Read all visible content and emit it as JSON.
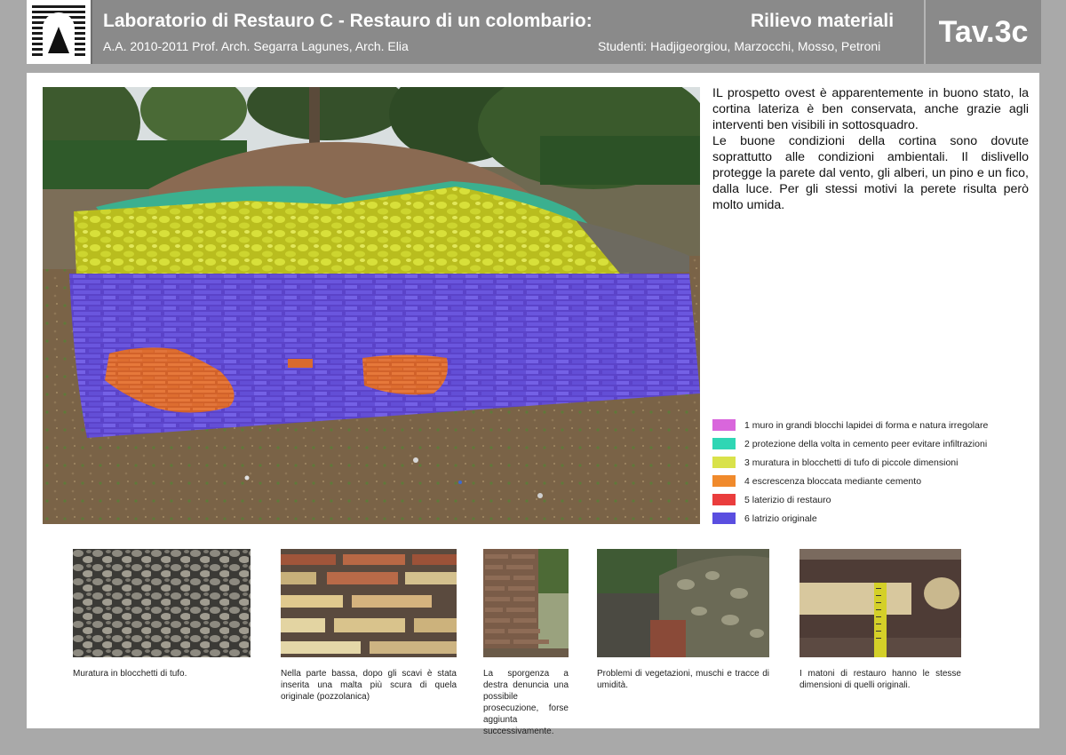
{
  "header": {
    "title": "Laboratorio di Restauro C - Restauro di un colombario:",
    "subtitle": "A.A. 2010-2011 Prof. Arch. Segarra Lagunes, Arch. Elia",
    "right_title": "Rilievo materiali",
    "right_subtitle": "Studenti: Hadjigeorgiou, Marzocchi, Mosso, Petroni",
    "sheet": "Tav.3c"
  },
  "description": [
    "IL prospetto ovest è apparentemente in buono stato, la cortina lateriza è ben conservata, anche grazie agli interventi ben visibili in sottosquadro.",
    "Le buone condizioni della cortina sono dovute soprattutto alle condizioni ambientali. Il dislivello protegge la parete dal vento, gli alberi, un pino e un fico, dalla luce. Per gli stessi motivi la perete risulta però molto umida."
  ],
  "legend": [
    {
      "label": "1 muro in grandi blocchi lapidei di forma e natura irregolare",
      "color": "#d966dc"
    },
    {
      "label": "2 protezione della volta in cemento peer evitare infiltrazioni",
      "color": "#2fd6b4"
    },
    {
      "label": "3 muratura in blocchetti di tufo di piccole dimensioni",
      "color": "#d9e24a"
    },
    {
      "label": "4 escrescenza bloccata mediante cemento",
      "color": "#f08a2c"
    },
    {
      "label": "5 laterizio di restauro",
      "color": "#ea3d3d"
    },
    {
      "label": "6 latrizio originale",
      "color": "#5a4ee0"
    }
  ],
  "captions": [
    "Muratura in blocchetti di tufo.",
    "Nella parte bassa, dopo gli scavi è stata inserita una malta più scura di quela originale (pozzolanica)",
    "La sporgenza a destra denuncia una possibile prosecuzione, forse aggiunta successivamente.",
    "Problemi di vegetazioni, muschi e tracce di umidità.",
    "I matoni di restauro hanno le stesse dimensioni di quelli originali."
  ]
}
